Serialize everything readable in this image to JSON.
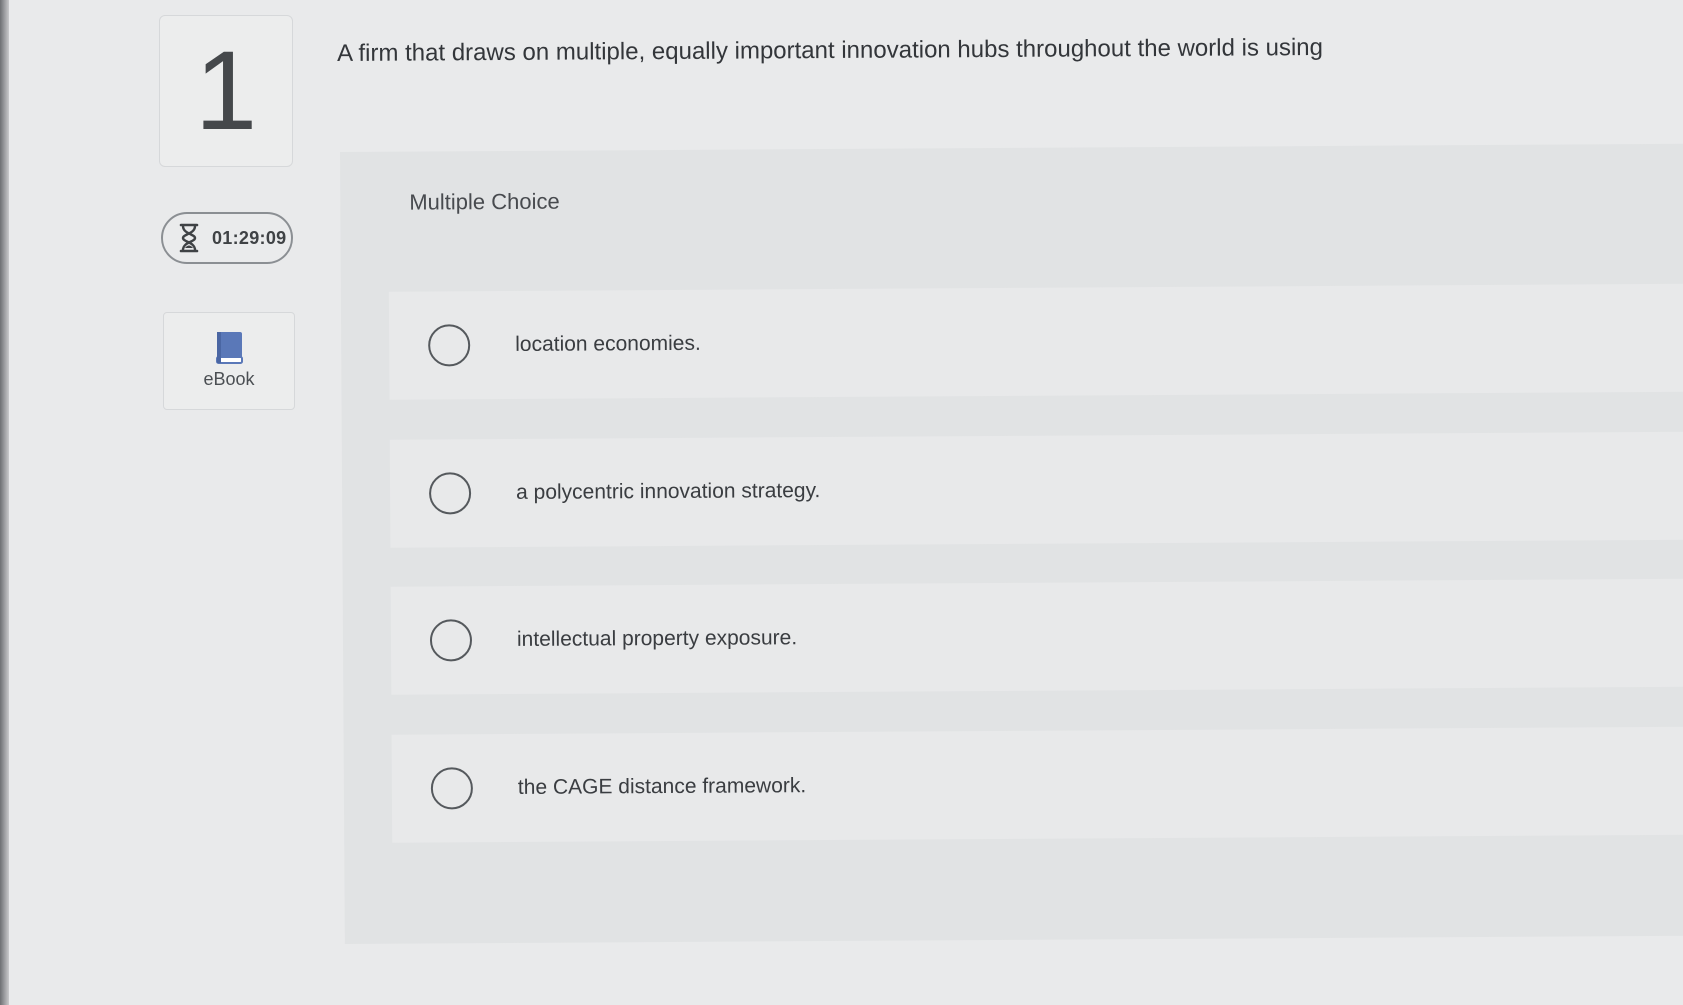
{
  "question": {
    "number": "1",
    "text": "A firm that draws on multiple, equally important innovation hubs throughout the world is using"
  },
  "timer": {
    "icon": "hourglass-icon",
    "value": "01:29:09"
  },
  "ebook": {
    "icon": "book-icon",
    "label": "eBook"
  },
  "answer_panel": {
    "type_label": "Multiple Choice",
    "options": [
      {
        "text": "location economies."
      },
      {
        "text": "a polycentric innovation strategy."
      },
      {
        "text": "intellectual property exposure."
      },
      {
        "text": "the CAGE distance framework."
      }
    ]
  },
  "colors": {
    "background": "#e9eaeb",
    "panel": "#e1e3e4",
    "option": "#e8e9ea",
    "ebook_icon": "#5a78b8"
  }
}
